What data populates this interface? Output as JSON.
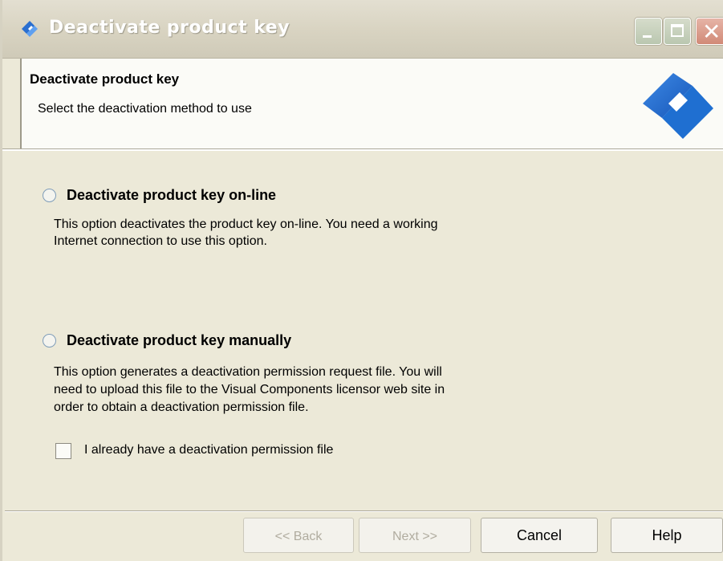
{
  "window": {
    "title": "Deactivate product key"
  },
  "header": {
    "title": "Deactivate product key",
    "subtitle": "Select the deactivation method to use"
  },
  "options": {
    "online": {
      "label": "Deactivate product key on-line",
      "description_line1": "This option deactivates the product key on-line. You need a working",
      "description_line2": "Internet connection to use this option.",
      "selected": false
    },
    "manual": {
      "label": "Deactivate product key manually",
      "description_line1": "This option generates a deactivation permission request file. You will",
      "description_line2": "need to upload this file to the Visual Components licensor web site in",
      "description_line3": "order to obtain a deactivation permission file.",
      "selected": false
    },
    "has_file_checkbox": {
      "label": "I already have a deactivation permission file",
      "checked": false
    }
  },
  "buttons": {
    "back": "<< Back",
    "next": "Next >>",
    "cancel": "Cancel",
    "help": "Help"
  },
  "colors": {
    "window_bg": "#ece9d8",
    "header_bg": "#fbfbf7",
    "logo_blue": "#1f6fd1"
  },
  "icons": {
    "title_icon": "app-logo-icon",
    "minimize": "minimize-icon",
    "maximize": "maximize-icon",
    "close": "close-icon"
  }
}
